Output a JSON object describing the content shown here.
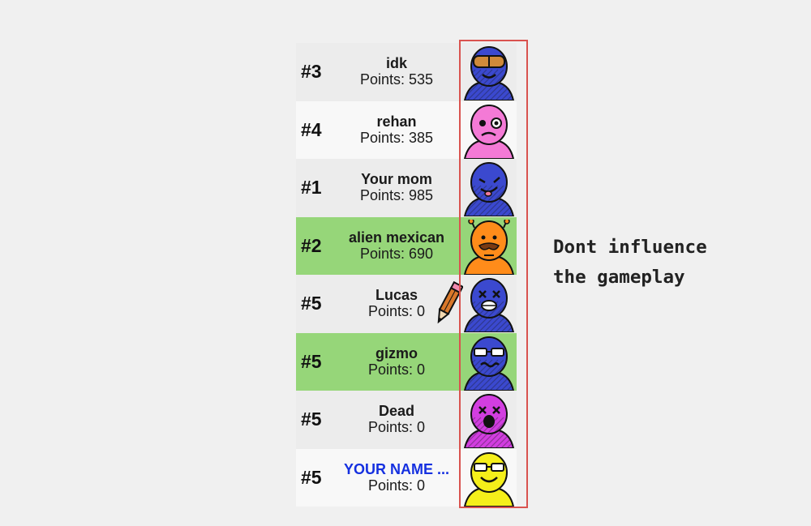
{
  "players": [
    {
      "rank": "#3",
      "name": "idk",
      "points": "Points: 535",
      "row_bg": "#ececec",
      "avatar": {
        "color": "#3b49cf",
        "icon": "avatar-goggles-icon"
      }
    },
    {
      "rank": "#4",
      "name": "rehan",
      "points": "Points: 385",
      "row_bg": "#f8f8f8",
      "avatar": {
        "color": "#f47ad6",
        "icon": "avatar-wink-icon"
      }
    },
    {
      "rank": "#1",
      "name": "Your mom",
      "points": "Points: 985",
      "row_bg": "#ececec",
      "avatar": {
        "color": "#3b49cf",
        "icon": "avatar-tongue-icon"
      }
    },
    {
      "rank": "#2",
      "name": "alien mexican",
      "points": "Points: 690",
      "row_bg": "#96d679",
      "avatar": {
        "color": "#ff8c1a",
        "icon": "avatar-alien-mustache-icon"
      }
    },
    {
      "rank": "#5",
      "name": "Lucas",
      "points": "Points: 0",
      "row_bg": "#ececec",
      "drawing": true,
      "avatar": {
        "color": "#3b49cf",
        "icon": "avatar-dizzy-icon"
      }
    },
    {
      "rank": "#5",
      "name": "gizmo",
      "points": "Points: 0",
      "row_bg": "#96d679",
      "avatar": {
        "color": "#3b49cf",
        "icon": "avatar-sunglasses-icon"
      }
    },
    {
      "rank": "#5",
      "name": "Dead",
      "points": "Points: 0",
      "row_bg": "#ececec",
      "avatar": {
        "color": "#d23ee0",
        "icon": "avatar-dead-icon"
      }
    },
    {
      "rank": "#5",
      "name": "YOUR NAME ...",
      "points": "Points: 0",
      "row_bg": "#f8f8f8",
      "self": true,
      "avatar": {
        "color": "#f5ef1a",
        "icon": "avatar-cool-icon"
      }
    }
  ],
  "annotation": {
    "line1": "Dont influence",
    "line2": "the gameplay",
    "highlight_color": "#d9534f"
  },
  "colors": {
    "highlight_row": "#96d679",
    "self_name": "#1530e0"
  }
}
